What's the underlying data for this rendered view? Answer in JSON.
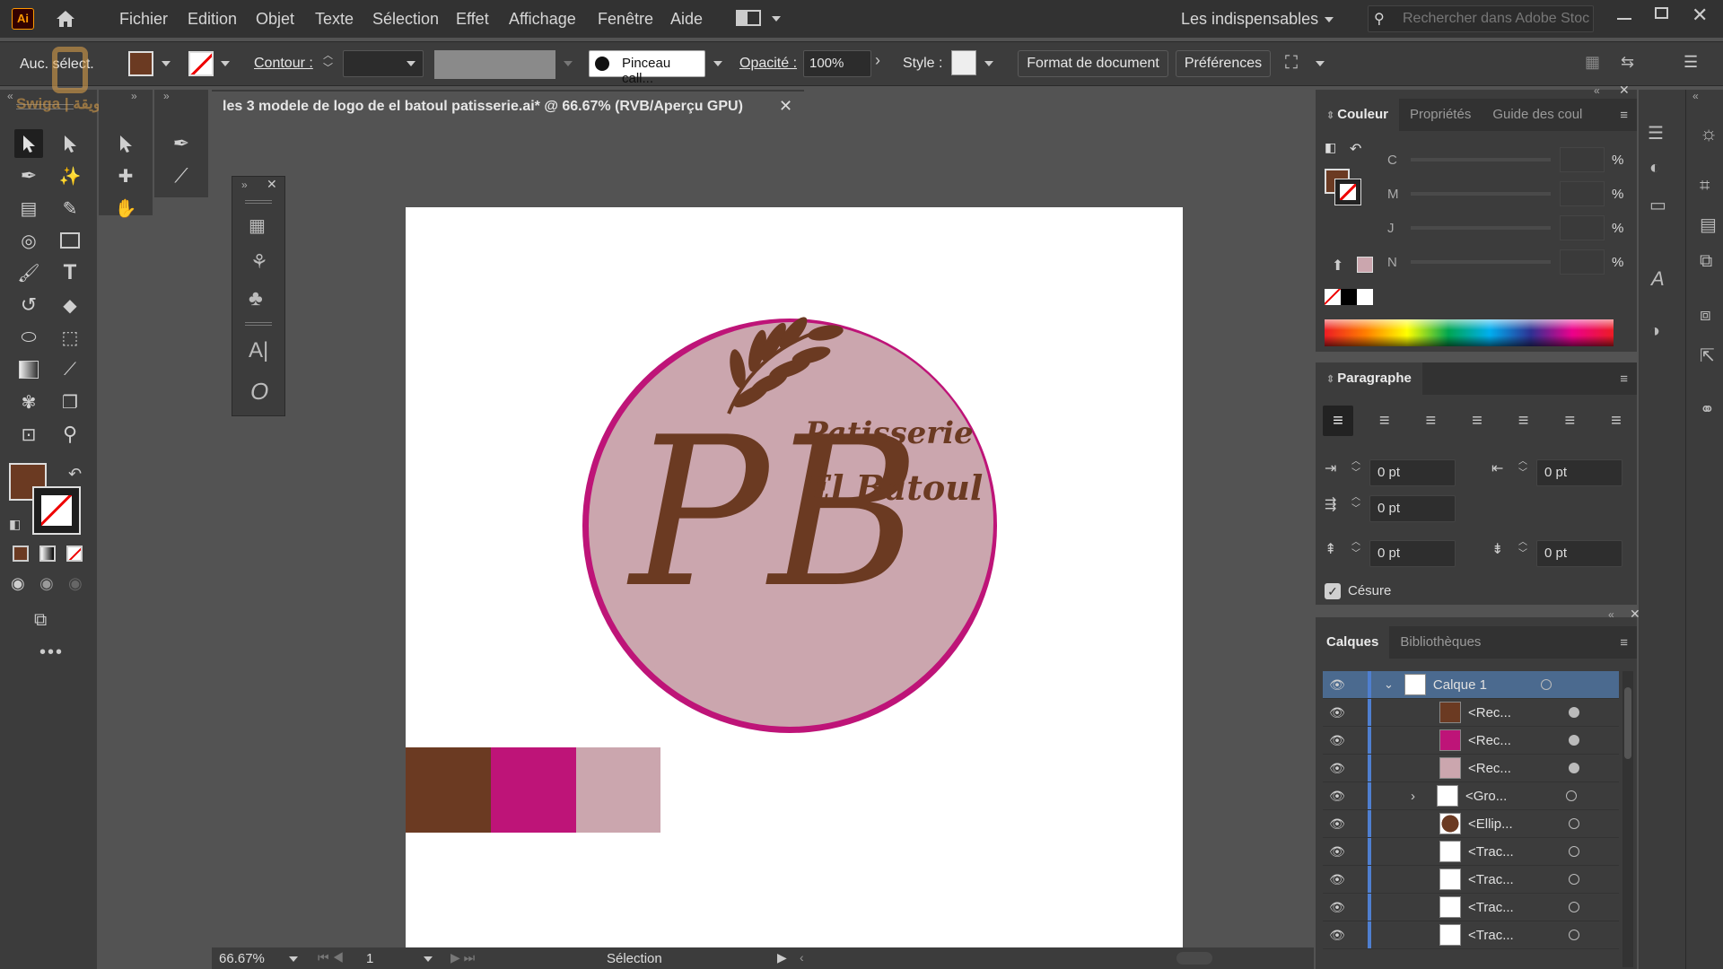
{
  "app": {
    "logo": "Ai",
    "workspace": "Les indispensables",
    "search_placeholder": "Rechercher dans Adobe Stoc",
    "watermark": "Swiga | سويقة"
  },
  "menu": [
    "Fichier",
    "Edition",
    "Objet",
    "Texte",
    "Sélection",
    "Effet",
    "Affichage",
    "Fenêtre",
    "Aide"
  ],
  "control": {
    "selection": "Auc. sélect.",
    "contour_label": "Contour :",
    "brush": "Pinceau call...",
    "opacity_label": "Opacité :",
    "opacity_value": "100%",
    "style_label": "Style :",
    "doc_format": "Format de document",
    "preferences": "Préférences"
  },
  "document": {
    "tab_title": "les 3 modele de logo de el batoul patisserie.ai* @ 66.67% (RVB/Aperçu GPU)"
  },
  "status": {
    "zoom": "66.67%",
    "artboard": "1",
    "tool": "Sélection"
  },
  "logo": {
    "line1": "Patisserie",
    "line2": "El Batoul",
    "monogram": "PB"
  },
  "swatches": {
    "brown": "#6b3a22",
    "magenta": "#be1478",
    "pink": "#cba6ae"
  },
  "color_panel": {
    "tabs": [
      "Couleur",
      "Propriétés",
      "Guide des coul"
    ],
    "channels": [
      "C",
      "M",
      "J",
      "N"
    ],
    "pct": "%"
  },
  "paragraph_panel": {
    "title": "Paragraphe",
    "fields": [
      "0 pt",
      "0 pt",
      "0 pt",
      "0 pt",
      "0 pt"
    ],
    "hyphenation": "Césure"
  },
  "layers_panel": {
    "tabs": [
      "Calques",
      "Bibliothèques"
    ],
    "rows": [
      "Calque 1",
      "<Rec...",
      "<Rec...",
      "<Rec...",
      "<Gro...",
      "<Ellip...",
      "<Trac...",
      "<Trac...",
      "<Trac...",
      "<Trac..."
    ]
  }
}
